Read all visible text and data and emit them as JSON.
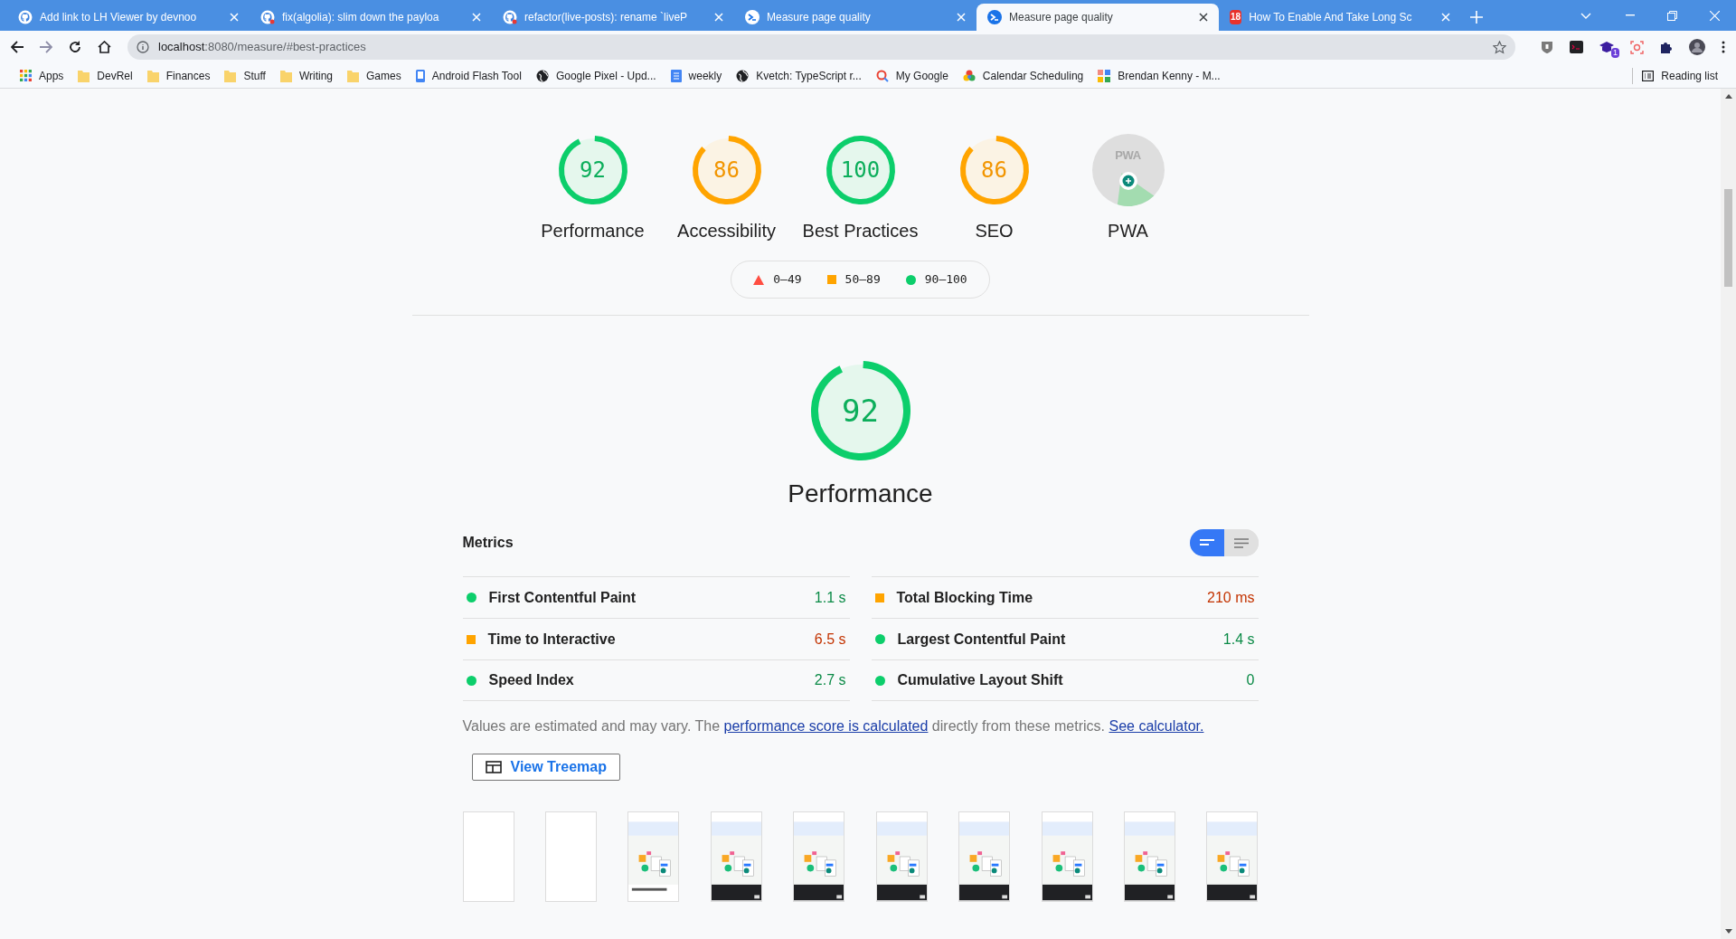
{
  "tabs": [
    {
      "title": "Add link to LH Viewer by devnoo",
      "kind": "github",
      "selected": false
    },
    {
      "title": "fix(algolia): slim down the payloa",
      "kind": "github-error",
      "selected": false
    },
    {
      "title": "refactor(live-posts): rename `liveP",
      "kind": "github-error",
      "selected": false
    },
    {
      "title": "Measure page quality",
      "kind": "lighthouse",
      "selected": false
    },
    {
      "title": "Measure page quality",
      "kind": "lighthouse",
      "selected": true
    },
    {
      "title": "How To Enable And Take Long Sc",
      "kind": "badge",
      "badge": "18",
      "selected": false
    }
  ],
  "address": {
    "host": "localhost",
    "rest": ":8080/measure/#best-practices"
  },
  "extension_badge": "1",
  "bookmarks": [
    {
      "label": "Apps",
      "kind": "apps"
    },
    {
      "label": "DevRel",
      "kind": "folder"
    },
    {
      "label": "Finances",
      "kind": "folder"
    },
    {
      "label": "Stuff",
      "kind": "folder"
    },
    {
      "label": "Writing",
      "kind": "folder"
    },
    {
      "label": "Games",
      "kind": "folder"
    },
    {
      "label": "Android Flash Tool",
      "kind": "phone"
    },
    {
      "label": "Google Pixel - Upd...",
      "kind": "globe"
    },
    {
      "label": "weekly",
      "kind": "doc"
    },
    {
      "label": "Kvetch: TypeScript r...",
      "kind": "globe"
    },
    {
      "label": "My Google",
      "kind": "google"
    },
    {
      "label": "Calendar Scheduling",
      "kind": "calendar"
    },
    {
      "label": "Brendan Kenny - M...",
      "kind": "moma"
    }
  ],
  "reading_list": "Reading list",
  "scores": [
    {
      "value": "92",
      "label": "Performance",
      "kind": "pass"
    },
    {
      "value": "86",
      "label": "Accessibility",
      "kind": "average"
    },
    {
      "value": "100",
      "label": "Best Practices",
      "kind": "pass"
    },
    {
      "value": "86",
      "label": "SEO",
      "kind": "average"
    },
    {
      "label": "PWA",
      "kind": "pwa",
      "badge": "PWA"
    }
  ],
  "legend": [
    {
      "kind": "fail",
      "range": "0–49"
    },
    {
      "kind": "average",
      "range": "50–89"
    },
    {
      "kind": "pass",
      "range": "90–100"
    }
  ],
  "category": {
    "value": "92",
    "label": "Performance",
    "kind": "pass"
  },
  "metrics_title": "Metrics",
  "view_toggle": [
    {
      "kind": "compact",
      "selected": true
    },
    {
      "kind": "expanded",
      "selected": false
    }
  ],
  "metrics": [
    {
      "name": "First Contentful Paint",
      "value": "1.1 s",
      "kind": "pass"
    },
    {
      "name": "Total Blocking Time",
      "value": "210 ms",
      "kind": "average"
    },
    {
      "name": "Time to Interactive",
      "value": "6.5 s",
      "kind": "average"
    },
    {
      "name": "Largest Contentful Paint",
      "value": "1.4 s",
      "kind": "pass"
    },
    {
      "name": "Speed Index",
      "value": "2.7 s",
      "kind": "pass"
    },
    {
      "name": "Cumulative Layout Shift",
      "value": "0",
      "kind": "pass"
    }
  ],
  "note": {
    "before": "Values are estimated and may vary. The ",
    "link": "performance score is calculated",
    "middle": " directly from these metrics. ",
    "link2": "See calculator."
  },
  "treemap_button": "View Treemap",
  "filmstrip": [
    {
      "kind": "blank"
    },
    {
      "kind": "blank"
    },
    {
      "kind": "hero"
    },
    {
      "kind": "banner"
    },
    {
      "kind": "banner"
    },
    {
      "kind": "banner"
    },
    {
      "kind": "banner"
    },
    {
      "kind": "banner"
    },
    {
      "kind": "banner"
    },
    {
      "kind": "banner"
    }
  ]
}
